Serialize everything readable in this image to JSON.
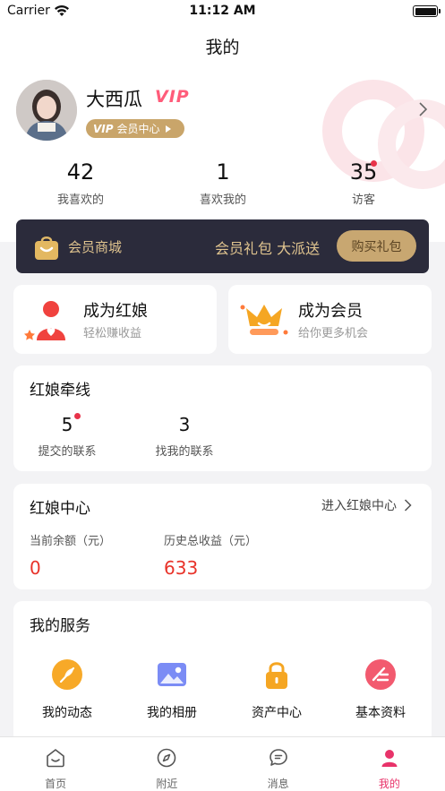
{
  "status_bar": {
    "carrier": "Carrier",
    "time": "11:12 AM"
  },
  "nav": {
    "title": "我的"
  },
  "profile": {
    "username": "大西瓜",
    "vip_mark": "VIP",
    "vip_center_badge": "VIP",
    "vip_center_label": "会员中心"
  },
  "stats": [
    {
      "value": "42",
      "label": "我喜欢的"
    },
    {
      "value": "1",
      "label": "喜欢我的"
    },
    {
      "value": "35",
      "label": "访客"
    }
  ],
  "vip_banner": {
    "shop_label": "会员商城",
    "promo_text": "会员礼包 大派送",
    "buy_button": "购买礼包"
  },
  "promo_cards": [
    {
      "title": "成为红娘",
      "subtitle": "轻松赚收益"
    },
    {
      "title": "成为会员",
      "subtitle": "给你更多机会"
    }
  ],
  "matchmaker_links": {
    "title": "红娘牵线",
    "items": [
      {
        "value": "5",
        "label": "提交的联系"
      },
      {
        "value": "3",
        "label": "找我的联系"
      }
    ]
  },
  "matchmaker_center": {
    "title": "红娘中心",
    "enter_link": "进入红娘中心",
    "balance_label": "当前余额（元）",
    "balance_value": "0",
    "earnings_label": "历史总收益（元）",
    "earnings_value": "633"
  },
  "services": {
    "title": "我的服务",
    "items": [
      {
        "label": "我的动态",
        "icon": "feather-icon",
        "color": "#f5a623"
      },
      {
        "label": "我的相册",
        "icon": "photo-album-icon",
        "color": "#7b8cf5"
      },
      {
        "label": "资产中心",
        "icon": "lock-icon",
        "color": "#f5a623"
      },
      {
        "label": "基本资料",
        "icon": "edit-profile-icon",
        "color": "#f25a6f"
      }
    ]
  },
  "tab_bar": [
    {
      "label": "首页",
      "icon": "home-icon"
    },
    {
      "label": "附近",
      "icon": "compass-icon"
    },
    {
      "label": "消息",
      "icon": "message-icon"
    },
    {
      "label": "我的",
      "icon": "profile-icon",
      "active": true
    }
  ],
  "colors": {
    "accent_pink": "#e8336a",
    "vip_gold": "#c9a56a",
    "money_red": "#e8332a",
    "banner_dark": "#2b2b3b"
  }
}
